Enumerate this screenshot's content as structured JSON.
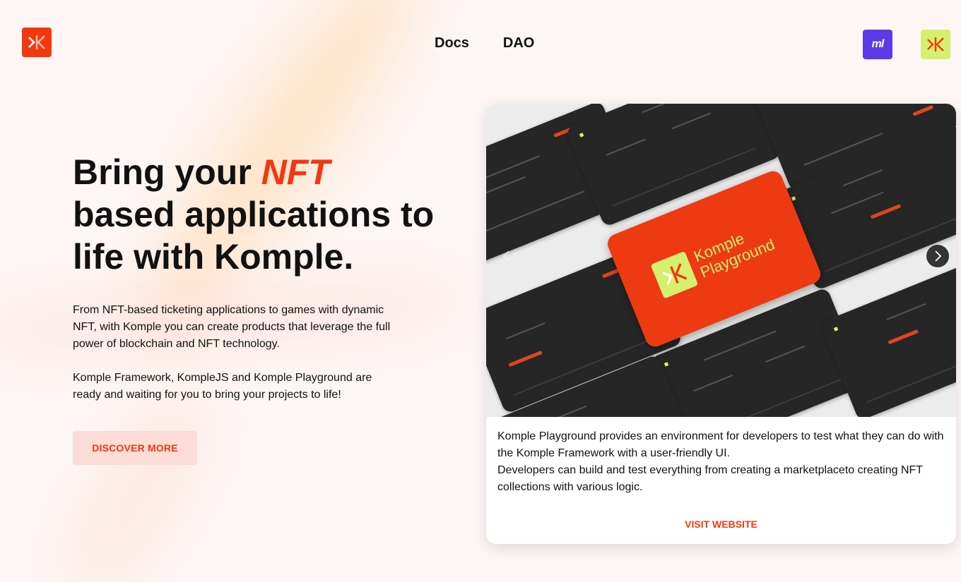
{
  "header": {
    "nav": [
      "Docs",
      "DAO"
    ],
    "ml_logo_text": "ml"
  },
  "hero": {
    "title_before": "Bring your ",
    "title_accent": "NFT",
    "title_after": " based applications to life with Komple.",
    "paragraph1": "From NFT-based ticketing applications to games with dynamic NFT, with Komple you can create products that leverage the full power of blockchain and NFT technology.",
    "paragraph2": "Komple Framework, KompleJS and Komple Playground are ready and waiting for you to bring your projects to life!",
    "cta": "DISCOVER MORE"
  },
  "card": {
    "image_label_line1": "Komple",
    "image_label_line2": "Playground",
    "description1": "Komple Playground provides an environment for developers to test what they can do with the Komple Framework with a user-friendly UI.",
    "description2": "Developers can build and test everything from creating a marketplaceto creating NFT collections with various logic.",
    "cta": "VISIT WEBSITE"
  },
  "colors": {
    "accent": "#f2380f",
    "lime": "#d5ef6e",
    "purple": "#5b3be8",
    "background": "#fdf6f5"
  },
  "icons": {
    "logo": "komple-logo-icon",
    "ml": "ml-logo-icon",
    "playground": "komple-playground-logo-icon",
    "next": "chevron-right-icon",
    "prev": "chevron-left-icon"
  }
}
